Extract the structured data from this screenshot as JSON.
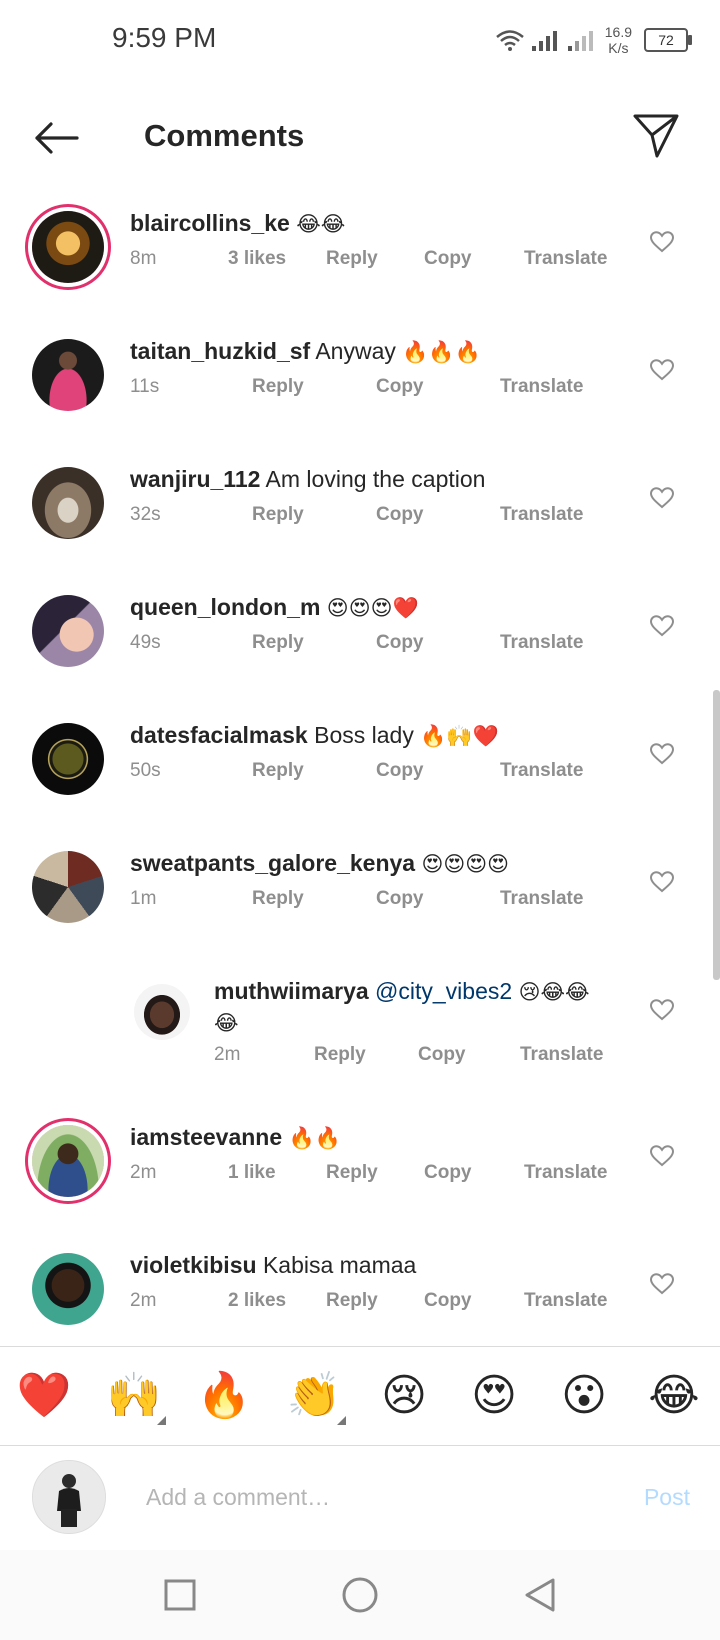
{
  "status_bar": {
    "time": "9:59 PM",
    "speed_top": "16.9",
    "speed_bottom": "K/s",
    "battery": "72"
  },
  "header": {
    "title": "Comments"
  },
  "comments": [
    {
      "username": "blaircollins_ke",
      "text": "",
      "emoji": "😂😂",
      "time": "8m",
      "likes": "3 likes",
      "reply": "Reply",
      "copy": "Copy",
      "translate": "Translate"
    },
    {
      "username": "taitan_huzkid_sf",
      "text": "Anyway",
      "emoji": "🔥🔥🔥",
      "time": "11s",
      "likes": "",
      "reply": "Reply",
      "copy": "Copy",
      "translate": "Translate"
    },
    {
      "username": "wanjiru_112",
      "text": "Am loving the caption",
      "emoji": "",
      "time": "32s",
      "likes": "",
      "reply": "Reply",
      "copy": "Copy",
      "translate": "Translate"
    },
    {
      "username": "queen_london_m",
      "text": "",
      "emoji": "😍😍😍❤️",
      "time": "49s",
      "likes": "",
      "reply": "Reply",
      "copy": "Copy",
      "translate": "Translate"
    },
    {
      "username": "datesfacialmask",
      "text": "Boss lady",
      "emoji": "🔥🙌❤️",
      "time": "50s",
      "likes": "",
      "reply": "Reply",
      "copy": "Copy",
      "translate": "Translate"
    },
    {
      "username": "sweatpants_galore_kenya",
      "text": "",
      "emoji": "😍😍😍😍",
      "time": "1m",
      "likes": "",
      "reply": "Reply",
      "copy": "Copy",
      "translate": "Translate"
    },
    {
      "username": "muthwiimarya",
      "mention": "@city_vibes2",
      "emoji": "😢😂😂",
      "emoji_wrap": "😂",
      "time": "2m",
      "likes": "",
      "reply": "Reply",
      "copy": "Copy",
      "translate": "Translate"
    },
    {
      "username": "iamsteevanne",
      "text": "",
      "emoji": "🔥🔥",
      "time": "2m",
      "likes": "1 like",
      "reply": "Reply",
      "copy": "Copy",
      "translate": "Translate"
    },
    {
      "username": "violetkibisu",
      "text": "Kabisa mamaa",
      "emoji": "",
      "time": "2m",
      "likes": "2 likes",
      "reply": "Reply",
      "copy": "Copy",
      "translate": "Translate"
    }
  ],
  "quick_emojis": [
    "❤️",
    "🙌",
    "🔥",
    "👏",
    "😢",
    "😍",
    "😮",
    "😂"
  ],
  "composer": {
    "placeholder": "Add a comment…",
    "post": "Post"
  },
  "colors": {
    "story_ring": "#e1306c",
    "post_disabled": "#b3dbff",
    "mention": "#00376b",
    "meta_gray": "#8e8e8e"
  }
}
